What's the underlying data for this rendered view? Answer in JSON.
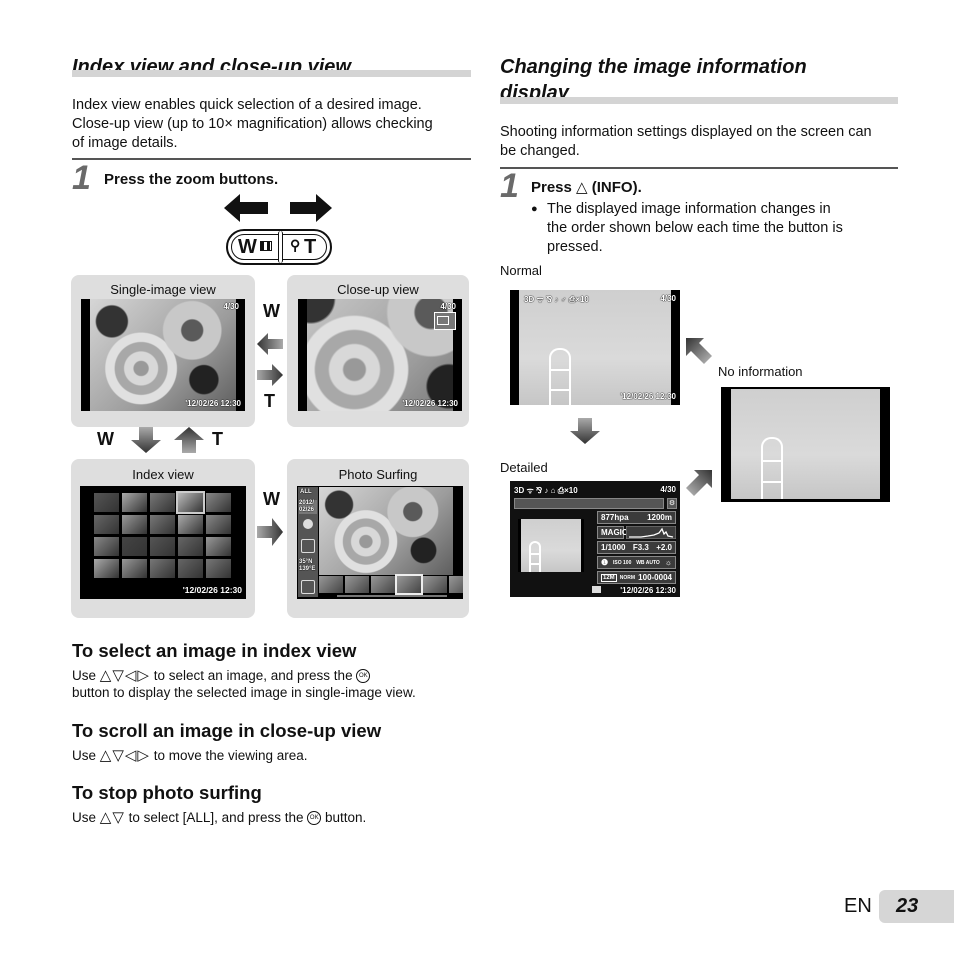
{
  "left": {
    "title": "Index view and close-up view",
    "intro": [
      "Index view enables quick selection of a desired image.",
      "Close-up view (up to 10× magnification) allows checking",
      "of image details."
    ],
    "step": {
      "number": "1",
      "text": "Press the zoom buttons."
    },
    "zoom_button": {
      "w_label": "W",
      "t_label": "T",
      "w_icon": "index-grid-icon",
      "t_icon": "magnifier-icon"
    },
    "panels": {
      "single": {
        "label": "Single-image view",
        "frame": "4/30",
        "datetime": "'12/02/26  12:30"
      },
      "closeup": {
        "label": "Close-up view",
        "frame": "4/30",
        "datetime": "'12/02/26  12:30"
      },
      "index": {
        "label": "Index view",
        "datetime": "'12/02/26  12:30"
      },
      "surfing": {
        "label": "Photo Surfing",
        "side_items": [
          "ALL",
          "2012/ 02/26",
          "",
          "",
          "35°N 139°E",
          ""
        ]
      }
    },
    "nav_keys": {
      "w": "W",
      "t": "T"
    },
    "subsections": [
      {
        "title": "To select an image in index view",
        "lines": [
          "Use △▽◁▷ to select an image, and press the ⓞ",
          "button to display the selected image in single-image view."
        ],
        "pre": "Use",
        "post1": "to select an image, and press the",
        "line2": "button to display the selected image in single-image view.",
        "ok": "OK"
      },
      {
        "title": "To scroll an image in close-up view",
        "pre": "Use",
        "post1": "to move the viewing area."
      },
      {
        "title": "To stop photo surfing",
        "pre": "Use",
        "post1": "to select [ALL], and press the",
        "post2": "button.",
        "ok": "OK"
      }
    ],
    "arrows": {
      "four": "△▽◁▷",
      "two": "△▽"
    }
  },
  "right": {
    "title_line1": "Changing the image information",
    "title_line2": "display",
    "intro": [
      "Shooting information settings displayed on the screen can",
      "be changed."
    ],
    "step": {
      "number": "1",
      "text_pre": "Press",
      "text_key": "△",
      "text_post": "(INFO)."
    },
    "bullet": [
      "The displayed image information changes in",
      "the order shown below each time the button is",
      "pressed."
    ],
    "bullet_mark": "●",
    "normal": {
      "label": "Normal",
      "icons": "3D ᯤ ⅋ ♪ ♂ ⎙×10",
      "frame": "4/30",
      "datetime": "'12/02/26  12:30"
    },
    "no_info": {
      "label": "No information"
    },
    "detailed": {
      "label": "Detailed",
      "icons": "3D ᯤ ⅋ ♪ ⌂ ⎙×10",
      "frame": "4/30",
      "pressure": "877hpa",
      "altitude": "1200m",
      "mode": "MAGIC",
      "shutter": "1/1000",
      "aperture": "F3.3",
      "exposure": "+2.0",
      "iso": "ISO 100",
      "wb": "WB AUTO",
      "size": "12M",
      "compression": "NORM",
      "file": "100-0004",
      "datetime": "'12/02/26  12:30"
    }
  },
  "footer": {
    "lang": "EN",
    "page": "23"
  }
}
